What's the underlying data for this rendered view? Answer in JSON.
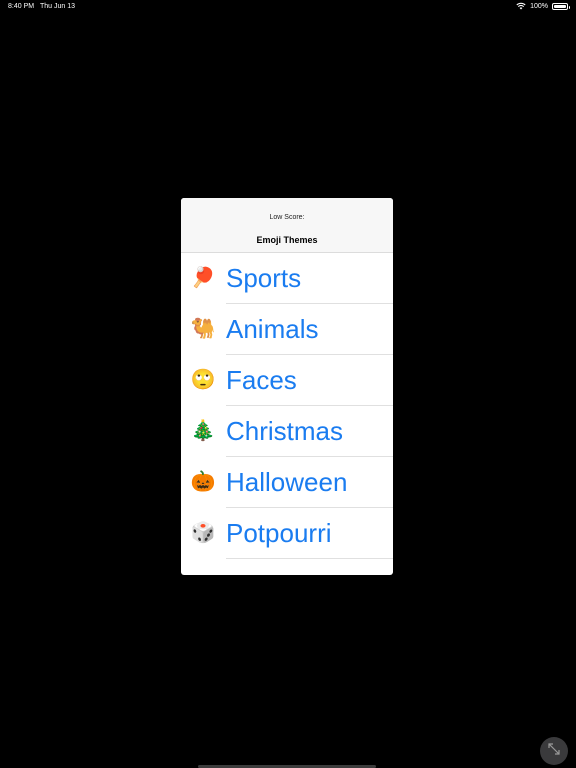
{
  "status_bar": {
    "time": "8:40 PM",
    "date": "Thu Jun 13",
    "battery": "100%",
    "battery_level": 1.0
  },
  "popover": {
    "low_score_label": "Low Score:",
    "title": "Emoji Themes",
    "themes": [
      {
        "emoji": "🏓",
        "icon": "ping-pong-icon",
        "label": "Sports"
      },
      {
        "emoji": "🐫",
        "icon": "camel-icon",
        "label": "Animals"
      },
      {
        "emoji": "🙄",
        "icon": "eye-roll-face-icon",
        "label": "Faces"
      },
      {
        "emoji": "🎄",
        "icon": "christmas-tree-icon",
        "label": "Christmas"
      },
      {
        "emoji": "🎃",
        "icon": "jack-o-lantern-icon",
        "label": "Halloween"
      },
      {
        "emoji": "🎲",
        "icon": "die-icon",
        "label": "Potpourri"
      }
    ]
  },
  "expand_button": {
    "icon": "expand-arrows-icon"
  },
  "colors": {
    "background": "#000000",
    "accent": "#1a7cf0",
    "card": "#ffffff",
    "header": "#f7f7f7"
  }
}
